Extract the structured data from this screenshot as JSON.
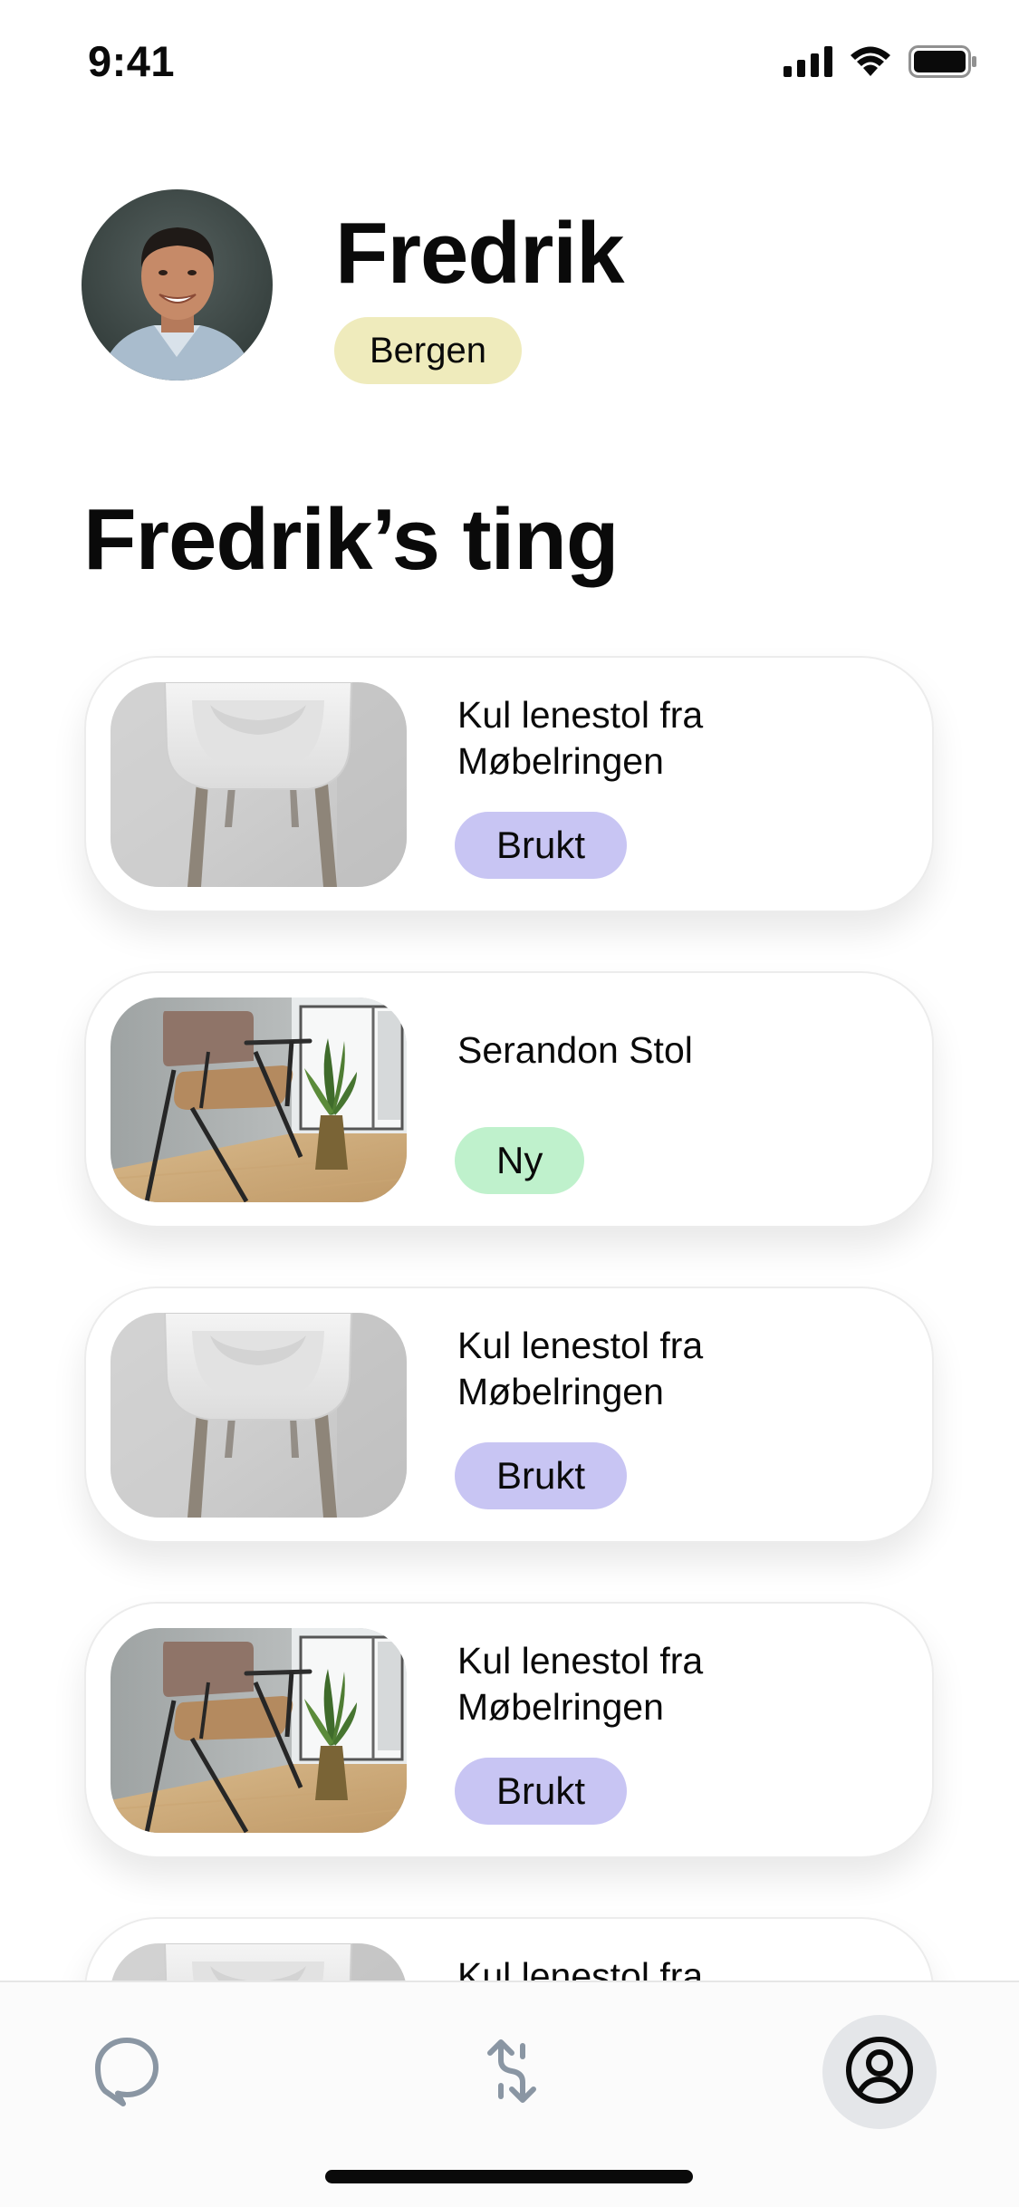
{
  "status_bar": {
    "time": "9:41",
    "icons": [
      "cellular-signal-icon",
      "wifi-icon",
      "battery-icon"
    ]
  },
  "profile": {
    "name": "Fredrik",
    "location": "Bergen",
    "avatar": "profile-photo"
  },
  "section": {
    "title": "Fredrik’s ting"
  },
  "items": [
    {
      "title": "Kul lenestol fra Møbelringen",
      "condition": "Brukt",
      "image": "white-chair-photo"
    },
    {
      "title": "Serandon Stol",
      "condition": "Ny",
      "image": "armchair-room-photo"
    },
    {
      "title": "Kul lenestol fra Møbelringen",
      "condition": "Brukt",
      "image": "white-chair-photo"
    },
    {
      "title": "Kul lenestol fra Møbelringen",
      "condition": "Brukt",
      "image": "armchair-room-photo"
    },
    {
      "title": "Kul lenestol fra",
      "condition": "",
      "image": "white-chair-photo"
    }
  ],
  "tab_bar": {
    "tabs": [
      {
        "icon": "chat-bubble-icon",
        "active": false
      },
      {
        "icon": "swap-arrows-icon",
        "active": false
      },
      {
        "icon": "user-circle-icon",
        "active": true
      }
    ]
  },
  "colors": {
    "location_badge": "#efebbc",
    "used_badge": "#c8c5f3",
    "new_badge": "#bff1cc",
    "icon_gray": "#8a96a3",
    "active_tab_bg": "#e4e6e9"
  }
}
